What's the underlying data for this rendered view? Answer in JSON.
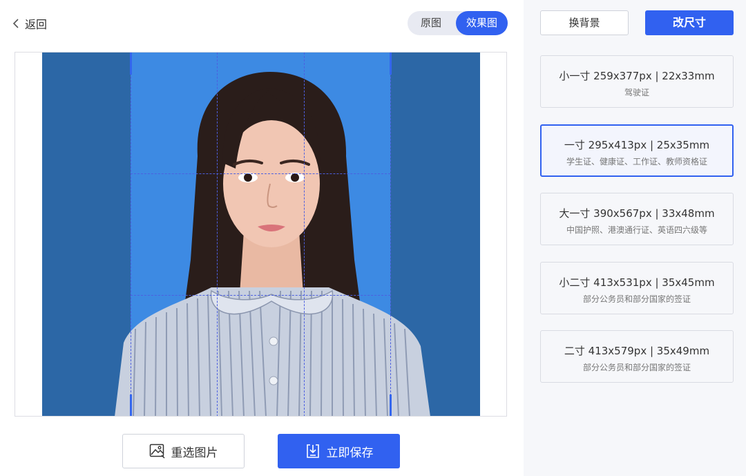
{
  "nav": {
    "back_label": "返回"
  },
  "view_toggle": {
    "original": "原图",
    "effect": "效果图",
    "active": "effect"
  },
  "actions": {
    "reselect_label": "重选图片",
    "save_label": "立即保存"
  },
  "side": {
    "background_label": "换背景",
    "resize_label": "改尺寸",
    "sizes": [
      {
        "name": "小一寸 259x377px | 22x33mm",
        "desc": "驾驶证",
        "selected": false
      },
      {
        "name": "一寸 295x413px | 25x35mm",
        "desc": "学生证、健康证、工作证、教师资格证",
        "selected": true
      },
      {
        "name": "大一寸 390x567px | 33x48mm",
        "desc": "中国护照、港澳通行证、英语四六级等",
        "selected": false
      },
      {
        "name": "小二寸 413x531px | 35x45mm",
        "desc": "部分公务员和部分国家的签证",
        "selected": false
      },
      {
        "name": "二寸 413x579px | 35x49mm",
        "desc": "部分公务员和部分国家的签证",
        "selected": false
      }
    ]
  },
  "colors": {
    "accent": "#3161f0",
    "photo_background": "#2c67a6",
    "crop_background": "#3d8ae3"
  }
}
